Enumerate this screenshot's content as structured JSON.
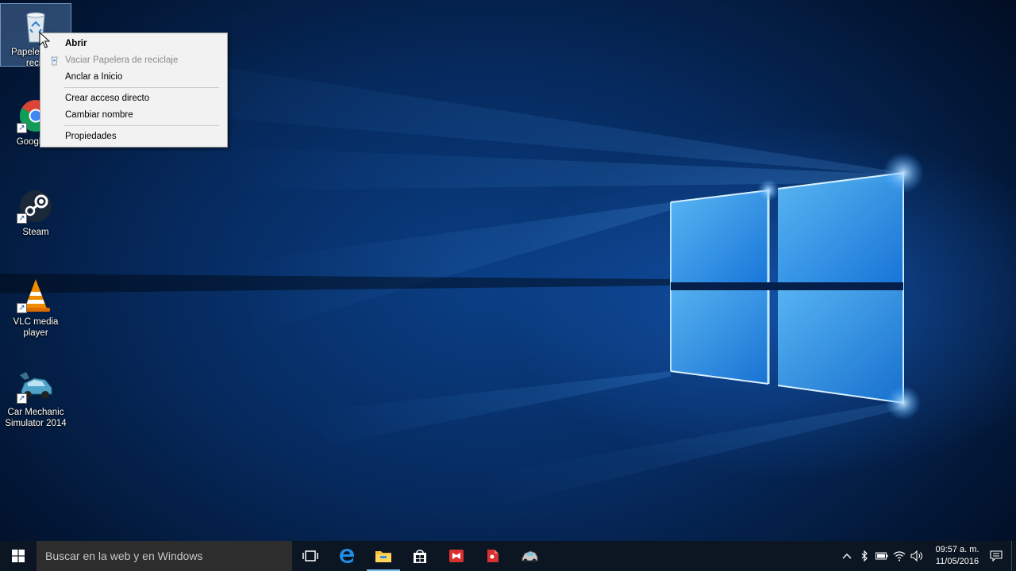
{
  "desktop_icons": [
    {
      "label": "Papelera de reciclaje",
      "visible_label": "Papelera de\nrecic",
      "icon": "recycle-bin-icon",
      "selected": true
    },
    {
      "label": "Google Chrome",
      "visible_label": "Google C",
      "icon": "chrome-icon"
    },
    {
      "label": "Steam",
      "icon": "steam-icon"
    },
    {
      "label": "VLC media player",
      "icon": "vlc-icon"
    },
    {
      "label": "Car Mechanic Simulator 2014",
      "visible_label": "Car Mechanic\nSimulator 2014",
      "icon": "car-mechanic-icon"
    }
  ],
  "context_menu": {
    "items": [
      {
        "label": "Abrir",
        "bold": true
      },
      {
        "label": "Vaciar Papelera de reciclaje",
        "disabled": true,
        "icon": "recycle-bin-small-icon"
      },
      {
        "label": "Anclar a Inicio"
      },
      {
        "label": "Crear acceso directo"
      },
      {
        "label": "Cambiar nombre"
      },
      {
        "label": "Propiedades"
      }
    ]
  },
  "taskbar": {
    "search_placeholder": "Buscar en la web y en Windows",
    "apps": [
      {
        "name": "task-view-icon"
      },
      {
        "name": "edge-icon"
      },
      {
        "name": "file-explorer-icon",
        "active": true
      },
      {
        "name": "store-icon"
      },
      {
        "name": "red-app-icon"
      },
      {
        "name": "red-pin-app-icon"
      },
      {
        "name": "car-mechanic-taskbar-icon"
      }
    ],
    "tray": {
      "time": "09:57 a. m.",
      "date": "11/05/2016"
    }
  },
  "colors": {
    "taskbar_bg": "#0c1622",
    "accent": "#76b9ed",
    "menu_bg": "#f2f2f2"
  }
}
